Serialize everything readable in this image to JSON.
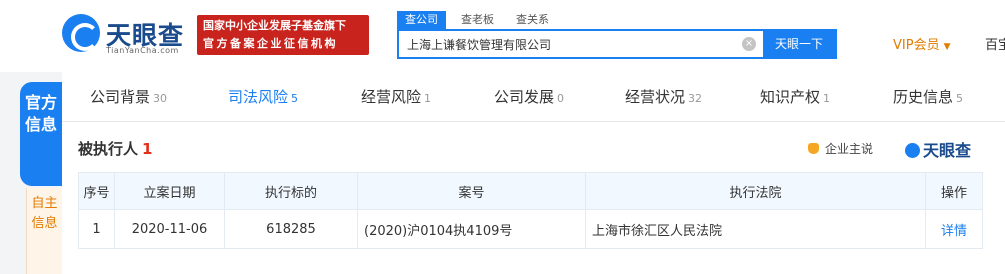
{
  "header": {
    "logo_cn": "天眼查",
    "logo_en": "TianYanCha.com",
    "banner_line1": "国家中小企业发展子基金旗下",
    "banner_line2": "官方备案企业征信机构",
    "search_tabs": [
      "查公司",
      "查老板",
      "查关系"
    ],
    "search_value": "上海上谦餐饮管理有限公司",
    "search_button": "天眼一下",
    "vip_label": "VIP会员",
    "cut_label": "百宝"
  },
  "side": {
    "official": "官方信息",
    "self": "自主信息"
  },
  "nav": [
    {
      "label": "公司背景",
      "count": "30"
    },
    {
      "label": "司法风险",
      "count": "5"
    },
    {
      "label": "经营风险",
      "count": "1"
    },
    {
      "label": "公司发展",
      "count": "0"
    },
    {
      "label": "经营状况",
      "count": "32"
    },
    {
      "label": "知识产权",
      "count": "1"
    },
    {
      "label": "历史信息",
      "count": "5"
    }
  ],
  "section": {
    "title": "被执行人",
    "count": "1",
    "complain_label": "企业主说",
    "brand": "天眼查"
  },
  "table": {
    "headers": [
      "序号",
      "立案日期",
      "执行标的",
      "案号",
      "执行法院",
      "操作"
    ],
    "rows": [
      [
        "1",
        "2020-11-06",
        "618285",
        "(2020)沪0104执4109号",
        "上海市徐汇区人民法院",
        "详情"
      ]
    ]
  }
}
